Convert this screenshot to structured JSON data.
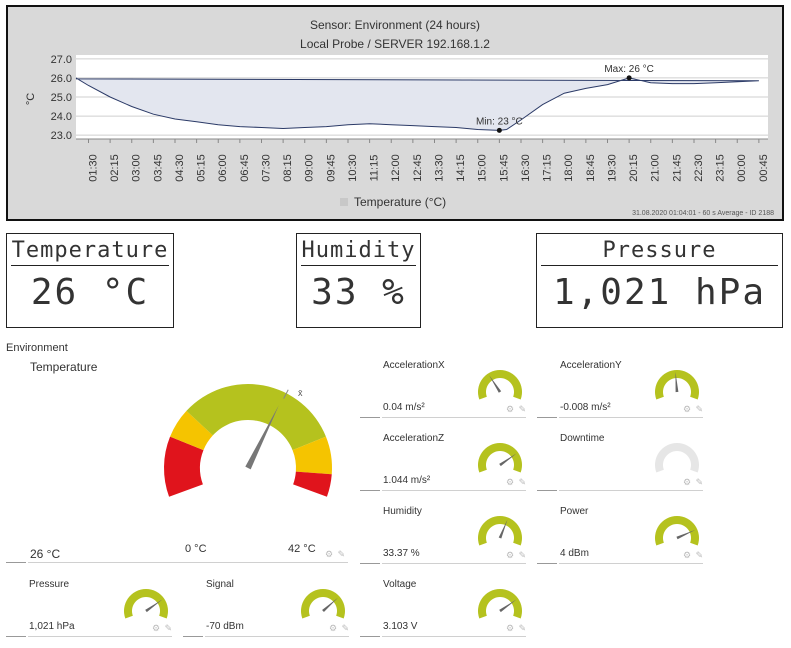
{
  "chart": {
    "title": "Sensor: Environment (24 hours)",
    "subtitle": "Local Probe / SERVER 192.168.1.2",
    "footer": "31.08.2020 01:04:01 - 60 s Average - ID 2188",
    "legend_label": "Temperature (°C)",
    "min_label": "Min: 23 °C",
    "max_label": "Max: 26 °C",
    "colors": {
      "line": "#2b3a67",
      "fill": "#e3e6ef",
      "background": "#d9d9d9",
      "plot": "#ffffff"
    }
  },
  "chart_data": {
    "type": "area",
    "ylabel": "°C",
    "ylim": [
      22.8,
      27.2
    ],
    "y_ticks": [
      "23.0",
      "24.0",
      "25.0",
      "26.0",
      "27.0"
    ],
    "y_tick_values": [
      23,
      24,
      25,
      26,
      27
    ],
    "x_ticks": [
      "01:30",
      "02:15",
      "03:00",
      "03:45",
      "04:30",
      "05:15",
      "06:00",
      "06:45",
      "07:30",
      "08:15",
      "09:00",
      "09:45",
      "10:30",
      "11:15",
      "12:00",
      "12:45",
      "13:30",
      "14:15",
      "15:00",
      "15:45",
      "16:30",
      "17:15",
      "18:00",
      "18:45",
      "19:30",
      "20:15",
      "21:00",
      "21:45",
      "22:30",
      "23:15",
      "00:00",
      "00:45"
    ],
    "series": [
      {
        "name": "Temperature (°C)",
        "x": [
          "01:04",
          "01:30",
          "02:15",
          "03:00",
          "03:45",
          "04:30",
          "05:15",
          "06:00",
          "06:45",
          "07:30",
          "08:15",
          "09:00",
          "09:45",
          "10:30",
          "11:15",
          "12:00",
          "12:45",
          "13:30",
          "14:15",
          "15:00",
          "15:45",
          "16:00",
          "16:30",
          "17:15",
          "18:00",
          "18:45",
          "19:30",
          "20:15",
          "21:00",
          "21:45",
          "22:30",
          "23:15",
          "00:00",
          "00:45",
          "01:04"
        ],
        "values": [
          26.0,
          25.6,
          25.0,
          24.5,
          24.1,
          23.85,
          23.7,
          23.55,
          23.45,
          23.4,
          23.35,
          23.4,
          23.45,
          23.55,
          23.6,
          23.55,
          23.5,
          23.45,
          23.4,
          23.3,
          23.25,
          23.3,
          23.8,
          24.6,
          25.2,
          25.45,
          25.65,
          26.0,
          25.75,
          25.7,
          25.7,
          25.75,
          25.8,
          25.85,
          25.95
        ]
      }
    ]
  },
  "lcds": [
    {
      "title": "Temperature",
      "value": "26 °C"
    },
    {
      "title": "Humidity",
      "value": "33 %"
    },
    {
      "title": "Pressure",
      "value": "1,021 hPa"
    }
  ],
  "section_label": "Environment",
  "main_gauge": {
    "name": "Temperature",
    "value": "26 °C",
    "min_label": "0 °C",
    "max_label": "42 °C",
    "mean_label": "x̄",
    "min": 0,
    "max": 42,
    "reading": 26,
    "bands": [
      {
        "from": 0,
        "to": 8,
        "color": "#e0141c"
      },
      {
        "from": 8,
        "to": 12,
        "color": "#f5c400"
      },
      {
        "from": 12,
        "to": 34,
        "color": "#b5c21e"
      },
      {
        "from": 34,
        "to": 39,
        "color": "#f5c400"
      },
      {
        "from": 39,
        "to": 42,
        "color": "#e0141c"
      }
    ]
  },
  "gauges": [
    {
      "name": "AccelerationX",
      "value": "0.04 m/s²",
      "level": 0.35,
      "active": true
    },
    {
      "name": "AccelerationY",
      "value": "-0.008 m/s²",
      "level": 0.48,
      "active": true
    },
    {
      "name": "AccelerationZ",
      "value": "1.044 m/s²",
      "level": 0.75,
      "active": true
    },
    {
      "name": "Downtime",
      "value": "",
      "level": 0,
      "active": false
    },
    {
      "name": "Humidity",
      "value": "33.37 %",
      "level": 0.6,
      "active": true
    },
    {
      "name": "Power",
      "value": "4 dBm",
      "level": 0.8,
      "active": true
    },
    {
      "name": "Pressure",
      "value": "1,021 hPa",
      "level": 0.75,
      "active": true
    },
    {
      "name": "Signal",
      "value": "-70 dBm",
      "level": 0.72,
      "active": true
    },
    {
      "name": "Voltage",
      "value": "3.103 V",
      "level": 0.75,
      "active": true
    }
  ],
  "tile_icons": "⚙ ✎",
  "gauge_color": "#b5c21e"
}
